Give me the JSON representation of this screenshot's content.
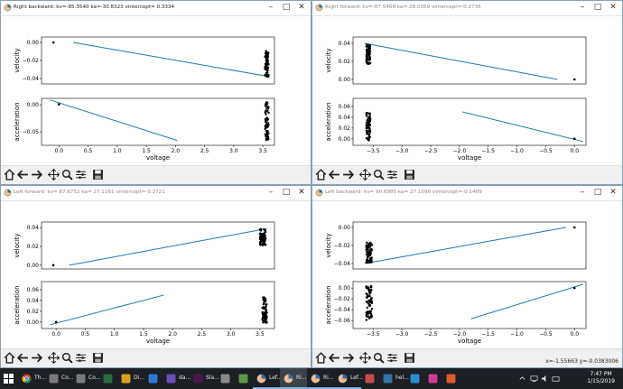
{
  "windows": [
    {
      "id": "w1",
      "title": "Right backward:  kv=-85.3540 ka=-30.8323 vintercept= 0.3334",
      "readout": "",
      "top": {
        "ylabel": "velocity",
        "xlim": [
          -0.2,
          3.7
        ],
        "ylim": [
          -0.046,
          0.006
        ],
        "yticks": [
          {
            "v": 0.0,
            "t": "0.00"
          },
          {
            "v": -0.02,
            "t": "−0.02"
          },
          {
            "v": -0.04,
            "t": "−0.04"
          }
        ],
        "xticks": [],
        "line": [
          [
            0.33,
            0.0
          ],
          [
            3.62,
            -0.038
          ]
        ],
        "points": [
          [
            0.0,
            0.0
          ]
        ],
        "cluster": {
          "x": [
            3.54,
            3.6
          ],
          "y": [
            -0.039,
            -0.009
          ]
        }
      },
      "bottom": {
        "ylabel": "acceleration",
        "xlabel": "voltage",
        "xlim": [
          -0.3,
          3.7
        ],
        "ylim": [
          -0.075,
          0.012
        ],
        "yticks": [
          {
            "v": 0.0,
            "t": "0.00"
          },
          {
            "v": -0.05,
            "t": "−0.05"
          }
        ],
        "xticks": [
          {
            "v": 0.0,
            "t": "0.0"
          },
          {
            "v": 0.5,
            "t": "0.5"
          },
          {
            "v": 1.0,
            "t": "1.0"
          },
          {
            "v": 1.5,
            "t": "1.5"
          },
          {
            "v": 2.0,
            "t": "2.0"
          },
          {
            "v": 2.5,
            "t": "2.5"
          },
          {
            "v": 3.0,
            "t": "3.0"
          },
          {
            "v": 3.5,
            "t": "3.5"
          }
        ],
        "line": [
          [
            -0.15,
            0.009
          ],
          [
            2.03,
            -0.066
          ]
        ],
        "points": [
          [
            0.0,
            0.001
          ]
        ],
        "cluster": {
          "x": [
            3.54,
            3.6
          ],
          "y": [
            -0.066,
            0.005
          ]
        }
      }
    },
    {
      "id": "w2",
      "title": "Right forward:  kv=-87.5468 ka=-28.0369 vintercept=-0.2736",
      "readout": "",
      "top": {
        "ylabel": "velocity",
        "xlim": [
          -3.85,
          0.2
        ],
        "ylim": [
          -0.005,
          0.047
        ],
        "yticks": [
          {
            "v": 0.04,
            "t": "0.04"
          },
          {
            "v": 0.02,
            "t": "0.02"
          },
          {
            "v": 0.0,
            "t": "0.00"
          }
        ],
        "xticks": [],
        "line": [
          [
            -3.65,
            0.04
          ],
          [
            -0.3,
            0.0
          ]
        ],
        "points": [
          [
            0.0,
            0.0
          ]
        ],
        "cluster": {
          "x": [
            -3.62,
            -3.55
          ],
          "y": [
            0.017,
            0.039
          ]
        }
      },
      "bottom": {
        "ylabel": "acceleration",
        "xlabel": "voltage",
        "xlim": [
          -3.85,
          0.2
        ],
        "ylim": [
          -0.012,
          0.075
        ],
        "yticks": [
          {
            "v": 0.06,
            "t": "0.06"
          },
          {
            "v": 0.04,
            "t": "0.04"
          },
          {
            "v": 0.02,
            "t": "0.02"
          },
          {
            "v": 0.0,
            "t": "0.00"
          }
        ],
        "xticks": [
          {
            "v": -3.5,
            "t": "−3.5"
          },
          {
            "v": -3.0,
            "t": "−3.0"
          },
          {
            "v": -2.5,
            "t": "−2.5"
          },
          {
            "v": -2.0,
            "t": "−2.0"
          },
          {
            "v": -1.5,
            "t": "−1.5"
          },
          {
            "v": -1.0,
            "t": "−1.0"
          },
          {
            "v": -0.5,
            "t": "−0.5"
          },
          {
            "v": 0.0,
            "t": "0.0"
          }
        ],
        "line": [
          [
            -1.95,
            0.05
          ],
          [
            0.15,
            -0.005
          ]
        ],
        "points": [
          [
            0.0,
            0.0
          ]
        ],
        "cluster": {
          "x": [
            -3.62,
            -3.55
          ],
          "y": [
            -0.003,
            0.048
          ]
        }
      }
    },
    {
      "id": "w3",
      "title": "Left forward:  kv= 87.6752 ka= 27.1161 vintercept= 0.2721",
      "readout": "",
      "top": {
        "ylabel": "velocity",
        "xlim": [
          -0.2,
          3.75
        ],
        "ylim": [
          -0.004,
          0.046
        ],
        "yticks": [
          {
            "v": 0.04,
            "t": "0.04"
          },
          {
            "v": 0.02,
            "t": "0.02"
          },
          {
            "v": 0.0,
            "t": "0.00"
          }
        ],
        "xticks": [],
        "line": [
          [
            0.27,
            0.0
          ],
          [
            3.62,
            0.039
          ]
        ],
        "points": [
          [
            0.0,
            0.0
          ]
        ],
        "cluster": {
          "x": [
            3.5,
            3.6
          ],
          "y": [
            0.021,
            0.039
          ]
        }
      },
      "bottom": {
        "ylabel": "acceleration",
        "xlabel": "voltage",
        "xlim": [
          -0.25,
          3.75
        ],
        "ylim": [
          -0.012,
          0.075
        ],
        "yticks": [
          {
            "v": 0.06,
            "t": "0.06"
          },
          {
            "v": 0.04,
            "t": "0.04"
          },
          {
            "v": 0.02,
            "t": "0.02"
          },
          {
            "v": 0.0,
            "t": "0.00"
          }
        ],
        "xticks": [
          {
            "v": 0.0,
            "t": "0.0"
          },
          {
            "v": 0.5,
            "t": "0.5"
          },
          {
            "v": 1.0,
            "t": "1.0"
          },
          {
            "v": 1.5,
            "t": "1.5"
          },
          {
            "v": 2.0,
            "t": "2.0"
          },
          {
            "v": 2.5,
            "t": "2.5"
          },
          {
            "v": 3.0,
            "t": "3.0"
          },
          {
            "v": 3.5,
            "t": "3.5"
          }
        ],
        "line": [
          [
            -0.1,
            -0.005
          ],
          [
            1.85,
            0.05
          ]
        ],
        "points": [
          [
            0.0,
            0.0
          ]
        ],
        "cluster": {
          "x": [
            3.54,
            3.62
          ],
          "y": [
            -0.002,
            0.048
          ]
        }
      }
    },
    {
      "id": "w4",
      "title": "Left backward:  kv= 90.6985 ka= 27.1098 vintercept=-0.1409",
      "readout": "x=-1.55663    y=-0.0383006",
      "top": {
        "ylabel": "velocity",
        "xlim": [
          -3.85,
          0.2
        ],
        "ylim": [
          -0.046,
          0.006
        ],
        "yticks": [
          {
            "v": 0.0,
            "t": "0.00"
          },
          {
            "v": -0.02,
            "t": "−0.02"
          },
          {
            "v": -0.04,
            "t": "−0.04"
          }
        ],
        "xticks": [],
        "line": [
          [
            -3.65,
            -0.04
          ],
          [
            -0.15,
            0.0
          ]
        ],
        "points": [
          [
            0.0,
            0.0
          ]
        ],
        "cluster": {
          "x": [
            -3.62,
            -3.52
          ],
          "y": [
            -0.039,
            -0.016
          ]
        }
      },
      "bottom": {
        "ylabel": "acceleration",
        "xlabel": "voltage",
        "xlim": [
          -3.85,
          0.2
        ],
        "ylim": [
          -0.075,
          0.012
        ],
        "yticks": [
          {
            "v": 0.0,
            "t": "0.00"
          },
          {
            "v": -0.02,
            "t": "−0.02"
          },
          {
            "v": -0.04,
            "t": "−0.04"
          },
          {
            "v": -0.06,
            "t": "−0.06"
          }
        ],
        "xticks": [
          {
            "v": -3.5,
            "t": "−3.5"
          },
          {
            "v": -3.0,
            "t": "−3.0"
          },
          {
            "v": -2.5,
            "t": "−2.5"
          },
          {
            "v": -2.0,
            "t": "−2.0"
          },
          {
            "v": -1.5,
            "t": "−1.5"
          },
          {
            "v": -1.0,
            "t": "−1.0"
          },
          {
            "v": -0.5,
            "t": "−0.5"
          },
          {
            "v": 0.0,
            "t": "0.0"
          }
        ],
        "line": [
          [
            -1.8,
            -0.057
          ],
          [
            0.15,
            0.007
          ]
        ],
        "points": [
          [
            0.0,
            0.0
          ]
        ],
        "cluster": {
          "x": [
            -3.62,
            -3.52
          ],
          "y": [
            -0.06,
            0.004
          ]
        }
      }
    }
  ],
  "toolbar_icons": [
    "home-icon",
    "back-arrow-icon",
    "forward-arrow-icon",
    "pan-icon",
    "zoom-icon",
    "configure-icon",
    "save-icon"
  ],
  "taskbar": {
    "items": [
      {
        "icon": "windows-start-icon",
        "label": "",
        "color": "#ffffff"
      },
      {
        "icon": "chrome-icon",
        "label": "Th...",
        "color": "#f2b600"
      },
      {
        "icon": "terminal-icon",
        "label": "Co...",
        "color": "#7a7a7a"
      },
      {
        "icon": "terminal-icon",
        "label": "Co...",
        "color": "#7a7a7a"
      },
      {
        "icon": "app-icon",
        "label": "",
        "color": "#2d6b3f"
      },
      {
        "icon": "app-icon",
        "label": "Di...",
        "color": "#d8a11e"
      },
      {
        "icon": "vscode-icon",
        "label": "",
        "color": "#2b7bd6"
      },
      {
        "icon": "app-icon",
        "label": "da...",
        "color": "#6c4fb6"
      },
      {
        "icon": "slack-icon",
        "label": "Sla...",
        "color": "#4a154b"
      },
      {
        "icon": "app-icon",
        "label": "",
        "color": "#888888"
      },
      {
        "icon": "app-icon",
        "label": "",
        "color": "#5a9a4a"
      },
      {
        "icon": "plot-icon",
        "label": "Lef...",
        "color": "#e08a1e"
      },
      {
        "icon": "plot-icon",
        "label": "Ri...",
        "color": "#e08a1e"
      },
      {
        "icon": "plot-icon",
        "label": "Ri...",
        "color": "#e08a1e"
      },
      {
        "icon": "plot-icon",
        "label": "Lef...",
        "color": "#e08a1e"
      },
      {
        "icon": "app-icon",
        "label": "",
        "color": "#c94a4a"
      },
      {
        "icon": "python-icon",
        "label": "hel...",
        "color": "#3572a5"
      },
      {
        "icon": "app-icon",
        "label": "",
        "color": "#2a8fcf"
      },
      {
        "icon": "app-icon",
        "label": "",
        "color": "#cf3c8f"
      },
      {
        "icon": "app-icon",
        "label": "",
        "color": "#e05a2a"
      }
    ],
    "time": "7:47 PM",
    "date": "1/15/2019"
  }
}
